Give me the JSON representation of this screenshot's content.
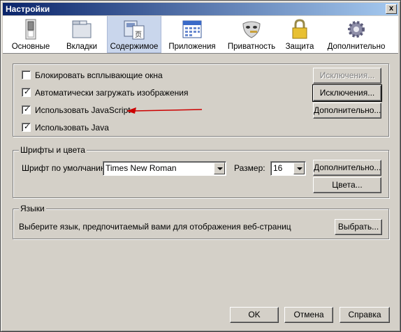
{
  "window": {
    "title": "Настройки",
    "close_symbol": "x"
  },
  "tabs": [
    {
      "label": "Основные",
      "icon": "switch-icon",
      "selected": false
    },
    {
      "label": "Вкладки",
      "icon": "folder-tabs-icon",
      "selected": false
    },
    {
      "label": "Содержимое",
      "icon": "content-page-icon",
      "selected": true
    },
    {
      "label": "Приложения",
      "icon": "applications-calendar-icon",
      "selected": false
    },
    {
      "label": "Приватность",
      "icon": "mask-icon",
      "selected": false
    },
    {
      "label": "Защита",
      "icon": "padlock-icon",
      "selected": false
    },
    {
      "label": "Дополнительно",
      "icon": "gear-icon",
      "selected": false
    }
  ],
  "content": {
    "checkboxes": [
      {
        "label": "Блокировать всплывающие окна",
        "checked": false
      },
      {
        "label": "Автоматически загружать изображения",
        "checked": true
      },
      {
        "label": "Использовать JavaScript",
        "checked": true
      },
      {
        "label": "Использовать Java",
        "checked": true
      }
    ],
    "exceptions_disabled_label": "Исключения...",
    "exceptions_label": "Исключения...",
    "advanced_label": "Дополнительно..."
  },
  "fonts": {
    "group_title": "Шрифты и цвета",
    "default_font_label": "Шрифт по умолчанию:",
    "default_font_value": "Times New Roman",
    "size_label": "Размер:",
    "size_value": "16",
    "advanced_label": "Дополнительно...",
    "colors_label": "Цвета..."
  },
  "languages": {
    "group_title": "Языки",
    "description": "Выберите язык, предпочитаемый вами для отображения веб-страниц",
    "choose_label": "Выбрать..."
  },
  "footer": {
    "ok_label": "OK",
    "cancel_label": "Отмена",
    "help_label": "Справка"
  },
  "annotation": {
    "arrow_color": "#cc0000"
  }
}
